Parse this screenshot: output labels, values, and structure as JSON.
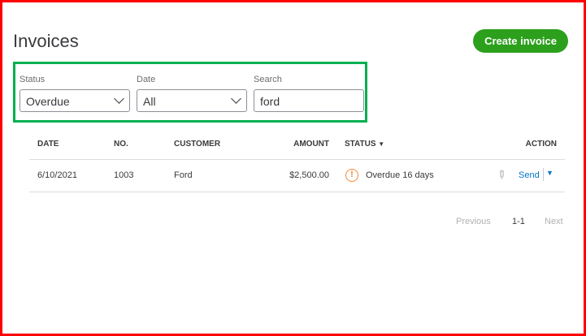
{
  "header": {
    "title": "Invoices",
    "create_label": "Create invoice"
  },
  "filters": {
    "status": {
      "label": "Status",
      "value": "Overdue"
    },
    "date": {
      "label": "Date",
      "value": "All"
    },
    "search": {
      "label": "Search",
      "value": "ford"
    }
  },
  "table": {
    "columns": [
      "DATE",
      "NO.",
      "CUSTOMER",
      "AMOUNT",
      "STATUS",
      "ACTION"
    ],
    "sort_indicator": "▼",
    "rows": [
      {
        "date": "6/10/2021",
        "no": "1003",
        "customer": "Ford",
        "amount": "$2,500.00",
        "status": "Overdue 16 days",
        "action": "Send"
      }
    ]
  },
  "pagination": {
    "previous": "Previous",
    "range": "1-1",
    "next": "Next"
  },
  "colors": {
    "accent": "#2ca01c",
    "link": "#0077c5",
    "warning": "#f4883b"
  }
}
